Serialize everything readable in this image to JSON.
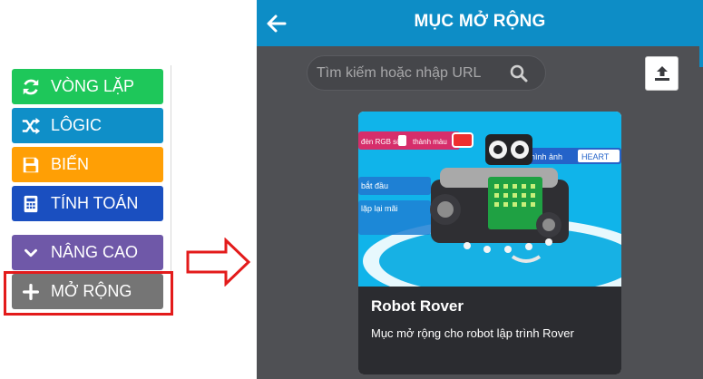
{
  "toolbox": {
    "categories": [
      {
        "label": "VÒNG LẶP",
        "icon": "refresh-icon",
        "color": "#1ec75a"
      },
      {
        "label": "LÔGIC",
        "icon": "shuffle-icon",
        "color": "#0f8fc8"
      },
      {
        "label": "BIẾN",
        "icon": "floppy-disk-icon",
        "color": "#ff9f05"
      },
      {
        "label": "TÍNH TOÁN",
        "icon": "calculator-icon",
        "color": "#1a4fc0"
      },
      {
        "label": "NÂNG CAO",
        "icon": "chevron-down-icon",
        "color": "#6f58a8"
      },
      {
        "label": "MỞ RỘNG",
        "icon": "plus-icon",
        "color": "#757575"
      }
    ],
    "highlight_color": "#e31b1b"
  },
  "dialog": {
    "title": "MỤC MỞ RỘNG",
    "header_color": "#0d8dc6",
    "search": {
      "placeholder": "Tìm kiếm hoặc nhập URL",
      "value": ""
    },
    "extensions": [
      {
        "title": "Robot Rover",
        "description": "Mục mở rộng cho robot lập trình Rover",
        "image_blocks": [
          "đèn RGB số",
          "thành màu",
          "hình ảnh",
          "HEART",
          "bắt đầu",
          "lặp lại mãi"
        ]
      }
    ]
  }
}
